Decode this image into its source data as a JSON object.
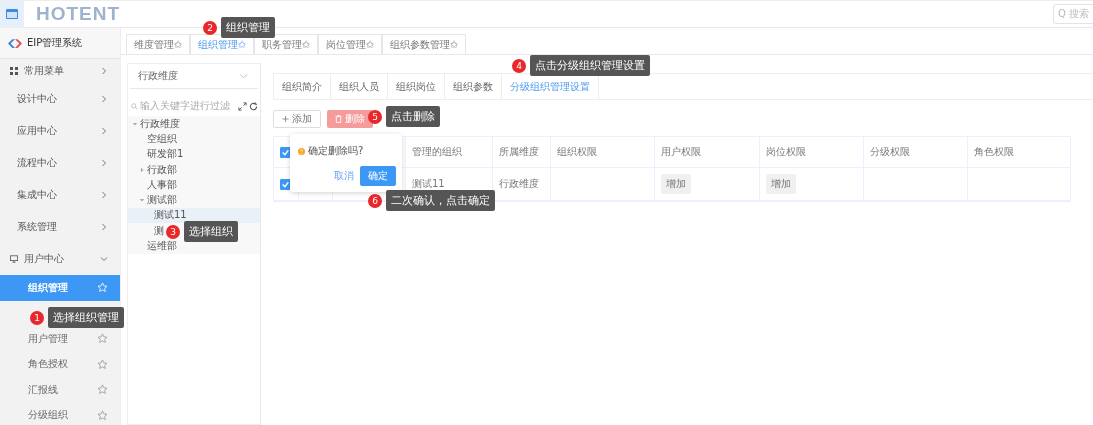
{
  "header": {
    "logo": "HOTENT",
    "search": {
      "placeholder": "Q 搜索"
    }
  },
  "sidebar": {
    "system": "EIP管理系统",
    "items": [
      {
        "label": "常用菜单",
        "kind": "grid",
        "expanded": false
      },
      {
        "label": "设计中心",
        "kind": "plain",
        "expanded": false
      },
      {
        "label": "应用中心",
        "kind": "plain",
        "expanded": false
      },
      {
        "label": "流程中心",
        "kind": "plain",
        "expanded": false
      },
      {
        "label": "集成中心",
        "kind": "plain",
        "expanded": false
      },
      {
        "label": "系统管理",
        "kind": "plain",
        "expanded": false
      },
      {
        "label": "用户中心",
        "kind": "monitor",
        "expanded": true
      }
    ],
    "subitems": [
      {
        "label": "组织管理",
        "selected": true,
        "kind": "item"
      },
      {
        "kind": "covered"
      },
      {
        "label": "用户管理",
        "selected": false,
        "kind": "item"
      },
      {
        "label": "角色授权",
        "selected": false,
        "kind": "item"
      },
      {
        "label": "汇报线",
        "selected": false,
        "kind": "item"
      },
      {
        "label": "分级组织",
        "selected": false,
        "kind": "item"
      }
    ]
  },
  "tabs": [
    {
      "label": "维度管理✩",
      "selected": false
    },
    {
      "label": "组织管理✩",
      "selected": true
    },
    {
      "label": "职务管理✩",
      "selected": false
    },
    {
      "label": "岗位管理✩",
      "selected": false
    },
    {
      "label": "组织参数管理✩",
      "selected": false
    }
  ],
  "tree_panel": {
    "dimension": "行政维度",
    "filter": {
      "placeholder": "输入关键字进行过滤"
    },
    "tree": [
      {
        "label": "行政维度",
        "expanded": true,
        "selected": false,
        "children": [
          {
            "label": "空组织",
            "selected": false
          },
          {
            "label": "研发部1",
            "selected": false
          },
          {
            "label": "行政部",
            "expanded": false,
            "selected": false
          },
          {
            "label": "人事部",
            "selected": false
          },
          {
            "label": "测试部",
            "expanded": true,
            "selected": false,
            "children": [
              {
                "label": "测试11",
                "selected": true
              },
              {
                "label": "测",
                "selected": false
              }
            ]
          },
          {
            "label": "运维部",
            "selected": false
          }
        ]
      }
    ]
  },
  "sub_tabs": [
    {
      "label": "组织简介",
      "selected": false
    },
    {
      "label": "组织人员",
      "selected": false
    },
    {
      "label": "组织岗位",
      "selected": false
    },
    {
      "label": "组织参数",
      "selected": false
    },
    {
      "label": "分级组织管理设置",
      "selected": true
    }
  ],
  "buttons": [
    {
      "label": "添加",
      "kind": "add"
    },
    {
      "label": "删除",
      "kind": "delete"
    }
  ],
  "table": {
    "header_checked": true,
    "columns": [
      "",
      "",
      "管理的组织",
      "所属维度",
      "组织权限",
      "用户权限",
      "岗位权限",
      "分级权限",
      "角色权限"
    ],
    "rows": [
      {
        "checked": true,
        "cells": [
          "",
          "",
          "测试11",
          "行政维度",
          "",
          "增加",
          "增加",
          "",
          ""
        ]
      }
    ]
  },
  "popconfirm": {
    "message": "确定删除吗?",
    "cancel": "取消",
    "ok": "确定"
  },
  "callouts": [
    {
      "number": "1",
      "text": "选择组织管理"
    },
    {
      "number": "2",
      "text": "组织管理"
    },
    {
      "number": "3",
      "text": "选择组织"
    },
    {
      "number": "4",
      "text": "点击分级组织管理设置"
    },
    {
      "number": "5",
      "text": "点击删除"
    },
    {
      "number": "6",
      "text": "二次确认，点击确定"
    }
  ]
}
